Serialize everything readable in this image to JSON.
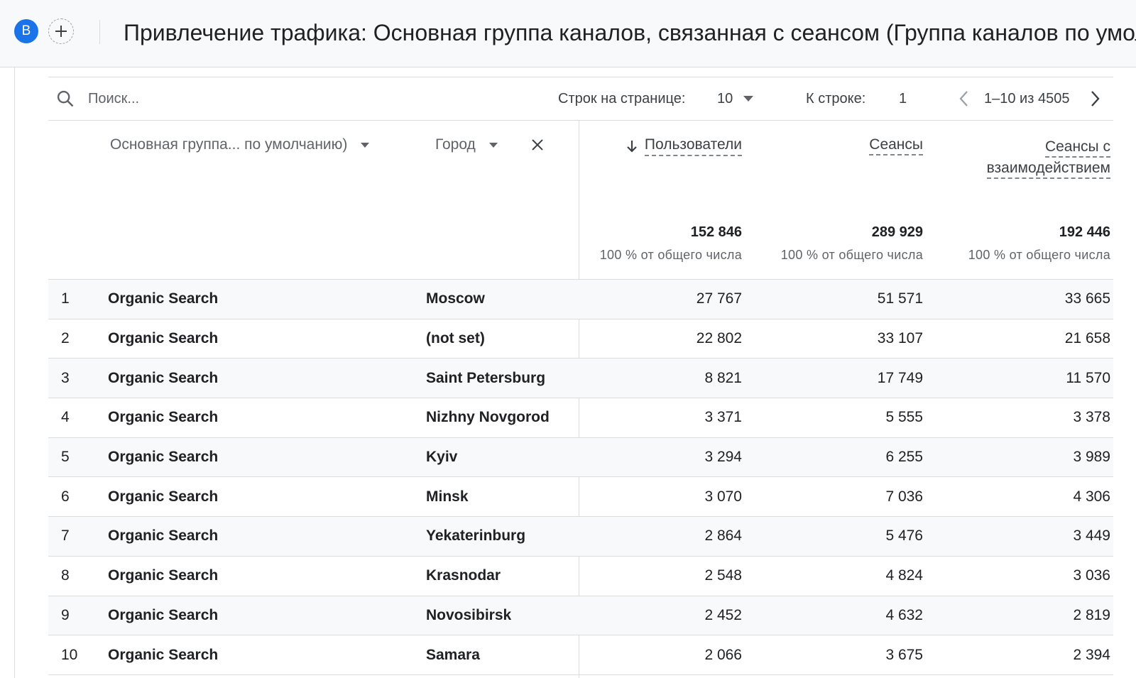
{
  "header": {
    "avatar_letter": "B",
    "add_label": "+",
    "title": "Привлечение трафика: Основная группа каналов, связанная с сеансом (Группа каналов по умолчанию)"
  },
  "toolbar": {
    "search_placeholder": "Поиск...",
    "rows_per_page_label": "Строк на странице:",
    "rows_per_page_value": "10",
    "goto_label": "К строке:",
    "goto_value": "1",
    "range_label": "1–10 из 4505"
  },
  "table": {
    "dimension1_header": "Основная группа... по умолчанию)",
    "dimension2_header": "Город",
    "metric_headers": [
      "Пользователи",
      "Сеансы",
      "Сеансы с взаимодействием"
    ],
    "sorted_column": "Пользователи",
    "totals": [
      {
        "value": "152 846",
        "pct": "100 % от общего числа"
      },
      {
        "value": "289 929",
        "pct": "100 % от общего числа"
      },
      {
        "value": "192 446",
        "pct": "100 % от общего числа"
      }
    ],
    "rows": [
      {
        "idx": "1",
        "channel": "Organic Search",
        "city": "Moscow",
        "users": "27 767",
        "sessions": "51 571",
        "engaged": "33 665"
      },
      {
        "idx": "2",
        "channel": "Organic Search",
        "city": "(not set)",
        "users": "22 802",
        "sessions": "33 107",
        "engaged": "21 658"
      },
      {
        "idx": "3",
        "channel": "Organic Search",
        "city": "Saint Petersburg",
        "users": "8 821",
        "sessions": "17 749",
        "engaged": "11 570"
      },
      {
        "idx": "4",
        "channel": "Organic Search",
        "city": "Nizhny Novgorod",
        "users": "3 371",
        "sessions": "5 555",
        "engaged": "3 378"
      },
      {
        "idx": "5",
        "channel": "Organic Search",
        "city": "Kyiv",
        "users": "3 294",
        "sessions": "6 255",
        "engaged": "3 989"
      },
      {
        "idx": "6",
        "channel": "Organic Search",
        "city": "Minsk",
        "users": "3 070",
        "sessions": "7 036",
        "engaged": "4 306"
      },
      {
        "idx": "7",
        "channel": "Organic Search",
        "city": "Yekaterinburg",
        "users": "2 864",
        "sessions": "5 476",
        "engaged": "3 449"
      },
      {
        "idx": "8",
        "channel": "Organic Search",
        "city": "Krasnodar",
        "users": "2 548",
        "sessions": "4 824",
        "engaged": "3 036"
      },
      {
        "idx": "9",
        "channel": "Organic Search",
        "city": "Novosibirsk",
        "users": "2 452",
        "sessions": "4 632",
        "engaged": "2 819"
      },
      {
        "idx": "10",
        "channel": "Organic Search",
        "city": "Samara",
        "users": "2 066",
        "sessions": "3 675",
        "engaged": "2 394"
      }
    ]
  },
  "colors": {
    "accent": "#1a73e8",
    "row_alt": "#f8f9fa",
    "divider": "#dadce0"
  }
}
